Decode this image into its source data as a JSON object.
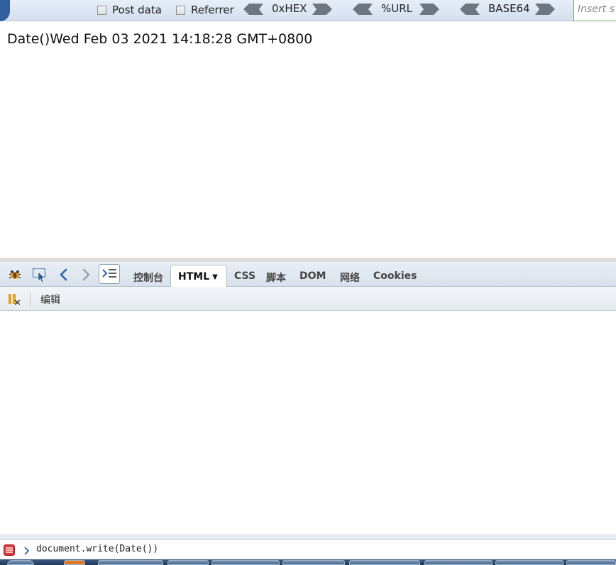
{
  "hackbar": {
    "post_data_label": "Post data",
    "referrer_label": "Referrer",
    "hex_label": "0xHEX",
    "url_label": "%URL",
    "base64_label": "BASE64",
    "insert_placeholder": "Insert s"
  },
  "page": {
    "content": "Date()Wed Feb 03 2021 14:18:28 GMT+0800"
  },
  "firebug": {
    "tabs": {
      "console": "控制台",
      "html": "HTML",
      "css": "CSS",
      "script": "脚本",
      "dom": "DOM",
      "net": "网络",
      "cookies": "Cookies"
    },
    "edit_label": "编辑",
    "command": "document.write(Date())"
  },
  "colors": {
    "accent": "#2f5f9d",
    "toolbar_bg": "#d9e2ec"
  }
}
